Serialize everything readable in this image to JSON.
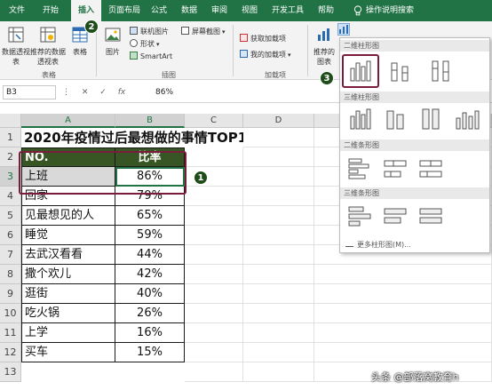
{
  "ribbon_tabs": [
    "文件",
    "开始",
    "插入",
    "页面布局",
    "公式",
    "数据",
    "审阅",
    "视图",
    "开发工具",
    "帮助",
    "操作说明搜索"
  ],
  "ribbon": {
    "tables_group": {
      "label": "表格",
      "buttons": [
        "数据透视表",
        "推荐的数据透视表",
        "表格"
      ]
    },
    "illustrations_group": {
      "label": "插图",
      "picture_label": "图片",
      "items": [
        "联机图片",
        "形状",
        "SmartArt",
        "屏幕截图"
      ]
    },
    "addins_group": {
      "label": "加载项",
      "items": [
        "获取加载项",
        "我的加载项"
      ]
    },
    "charts_group": {
      "recommended_label": "推荐的图表"
    }
  },
  "formula_bar": {
    "name_box": "B3",
    "value": "86%"
  },
  "columns": [
    "A",
    "B",
    "C",
    "D"
  ],
  "sheet": {
    "title": "2020年疫情过后最想做的事情TOP10",
    "header": [
      "NO.",
      "比率"
    ],
    "rows": [
      [
        "上班",
        "86%"
      ],
      [
        "回家",
        "79%"
      ],
      [
        "见最想见的人",
        "65%"
      ],
      [
        "睡觉",
        "59%"
      ],
      [
        "去武汉看看",
        "44%"
      ],
      [
        "撒个欢儿",
        "42%"
      ],
      [
        "逛街",
        "40%"
      ],
      [
        "吃火锅",
        "26%"
      ],
      [
        "上学",
        "16%"
      ],
      [
        "买车",
        "15%"
      ]
    ]
  },
  "chart_menu": {
    "sections": [
      "二维柱形图",
      "三维柱形图",
      "二维条形图",
      "三维条形图"
    ],
    "more": "更多柱形图(M)..."
  },
  "callouts": [
    "1",
    "2",
    "3"
  ],
  "watermark": "头条 @部落窝教育h",
  "colors": {
    "excel_green": "#217346",
    "header_fill": "#375623",
    "highlight": "#7a1d3d"
  }
}
